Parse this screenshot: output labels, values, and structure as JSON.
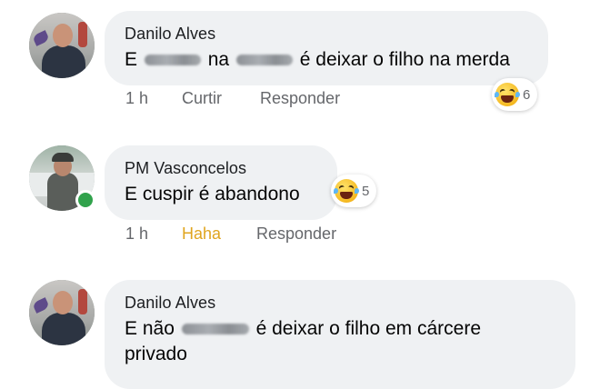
{
  "comments": [
    {
      "author": "Danilo Alves",
      "text_parts": [
        "E",
        "na",
        "é deixar o filho na merda"
      ],
      "time": "1 h",
      "action1": "Curtir",
      "action2": "Responder",
      "reaction_count": "6",
      "reaction_icon": "haha-emoji-icon",
      "action1_state": "normal"
    },
    {
      "author": "PM Vasconcelos",
      "text": "E cuspir é abandono",
      "time": "1 h",
      "action1": "Haha",
      "action2": "Responder",
      "reaction_count": "5",
      "reaction_icon": "haha-emoji-icon",
      "action1_state": "reacted",
      "online": true
    },
    {
      "author": "Danilo Alves",
      "text_parts": [
        "E não",
        "é deixar o filho em cárcere",
        "privado"
      ]
    }
  ],
  "colors": {
    "bubble": "#eff1f3",
    "meta_text": "#65676b",
    "haha_active": "#e0a51f",
    "online": "#31a24c"
  }
}
